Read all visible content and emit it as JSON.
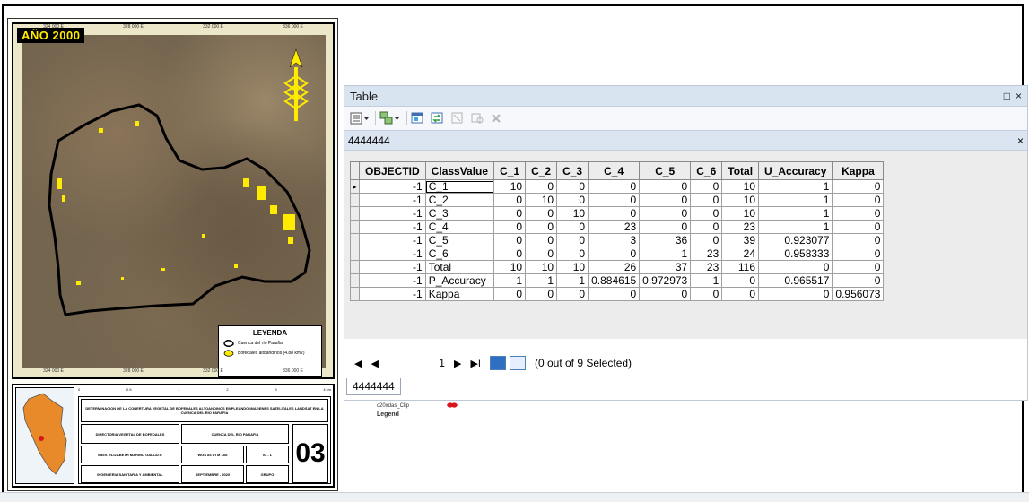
{
  "map": {
    "year_label": "AÑO 2000",
    "coords_top": [
      "324 000 E",
      "328 000 E",
      "332 000 E",
      "336 000 E"
    ],
    "coords_bottom": [
      "324 000 E",
      "328 000 E",
      "332 000 E",
      "336 000 E"
    ],
    "legend_title": "LEYENDA",
    "legend_items": [
      "Cuenca del río Parafia",
      "Bofedales altoandinos (4.88 km2)"
    ],
    "sheet_number": "03",
    "scale_labels": [
      "0",
      "0.5",
      "1",
      "2",
      "3",
      "4 km"
    ],
    "title_text": "DETERMINACION DE LA COBERTURA VEGETAL DE BOFEDALES ALTOANDINOS EMPLEANDO IMAGENES SATELITALES LANDSAT EN LA CUENCA DEL RIO PARAFIA",
    "cells": {
      "c1": "DIRECTORIA VEGETAL DE BOFEDALES",
      "c2": "CUENCA DEL RIO PARAFIA",
      "c3": "Bach. ELIZABETH MARINO GALLATE",
      "c4": "WGS 84 UTM 18S",
      "c5": "03 - L",
      "c6": "INGENIERIA SANITARIA Y AMBIENTAL",
      "c7": "SEPTIEMBRE - 2020",
      "c8": "GRUPO"
    }
  },
  "table_window": {
    "title": "Table",
    "restore_icon": "□",
    "close_icon": "×",
    "tab_name": "4444444",
    "tab_close": "×",
    "toolbar_icons": [
      "table-options-icon",
      "related-tables-icon",
      "select-by-attributes-icon",
      "switch-selection-icon",
      "clear-selection-icon",
      "zoom-to-selected-icon",
      "delete-selected-icon"
    ],
    "columns": [
      "OBJECTID",
      "ClassValue",
      "C_1",
      "C_2",
      "C_3",
      "C_4",
      "C_5",
      "C_6",
      "Total",
      "U_Accuracy",
      "Kappa"
    ],
    "rows": [
      [
        "-1",
        "C_1",
        "10",
        "0",
        "0",
        "0",
        "0",
        "0",
        "10",
        "1",
        "0"
      ],
      [
        "-1",
        "C_2",
        "0",
        "10",
        "0",
        "0",
        "0",
        "0",
        "10",
        "1",
        "0"
      ],
      [
        "-1",
        "C_3",
        "0",
        "0",
        "10",
        "0",
        "0",
        "0",
        "10",
        "1",
        "0"
      ],
      [
        "-1",
        "C_4",
        "0",
        "0",
        "0",
        "23",
        "0",
        "0",
        "23",
        "1",
        "0"
      ],
      [
        "-1",
        "C_5",
        "0",
        "0",
        "0",
        "3",
        "36",
        "0",
        "39",
        "0.923077",
        "0"
      ],
      [
        "-1",
        "C_6",
        "0",
        "0",
        "0",
        "0",
        "1",
        "23",
        "24",
        "0.958333",
        "0"
      ],
      [
        "-1",
        "Total",
        "10",
        "10",
        "10",
        "26",
        "37",
        "23",
        "116",
        "0",
        "0"
      ],
      [
        "-1",
        "P_Accuracy",
        "1",
        "1",
        "1",
        "0.884615",
        "0.972973",
        "1",
        "0",
        "0.965517",
        "0"
      ],
      [
        "-1",
        "Kappa",
        "0",
        "0",
        "0",
        "0",
        "0",
        "0",
        "0",
        "0",
        "0.956073"
      ]
    ],
    "row_pointer": "▸",
    "nav": {
      "first": "I◀",
      "prev": "◀",
      "current_record": "1",
      "next": "▶",
      "last": "▶I",
      "status": "(0 out of 9 Selected)"
    },
    "bottom_tab": "4444444"
  },
  "under_legend": {
    "layer_name": "c20xdas_Clip",
    "legend_label": "Legend"
  },
  "colors": {
    "titlebar": "#d9e4f1",
    "bofedales": "#ffeb00",
    "year_label_bg": "#000000",
    "red_mark": "#d8141c"
  }
}
